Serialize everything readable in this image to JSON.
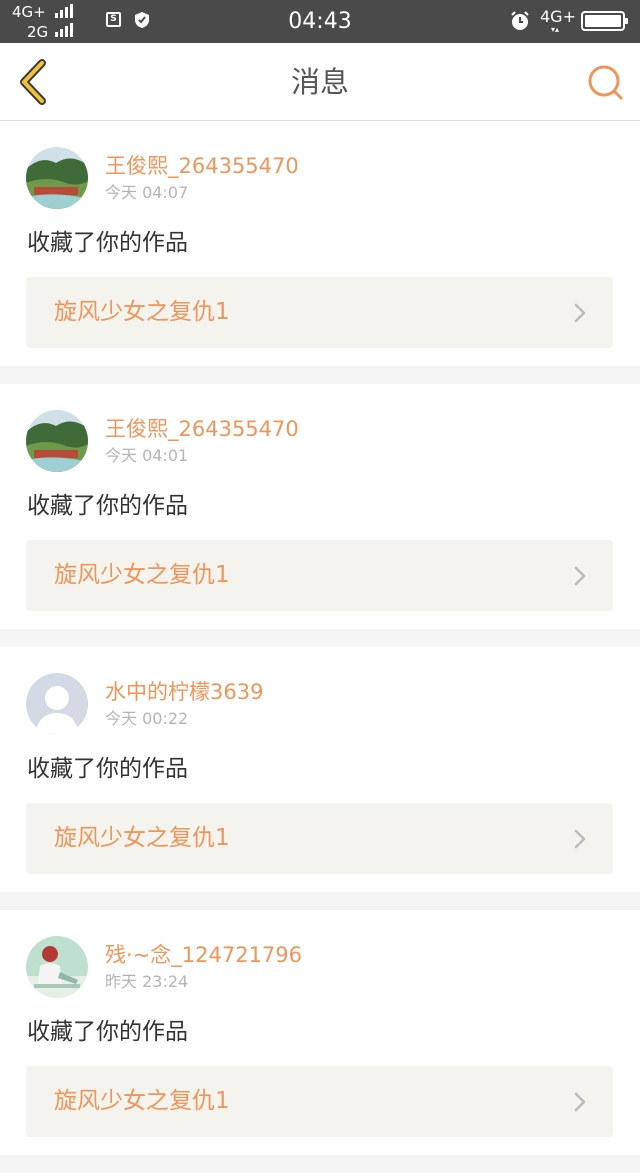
{
  "status_bar": {
    "network_top": "4G+",
    "network_bottom": "2G",
    "time": "04:43",
    "network_right": "4G+",
    "sim_icon_letter": "S"
  },
  "nav": {
    "title": "消息",
    "back_icon": "chevron-left-icon",
    "search_icon": "search-icon",
    "accent_color": "#f0955a"
  },
  "messages": [
    {
      "user": "王俊熙_264355470",
      "time": "今天 04:07",
      "action": "收藏了你的作品",
      "work": "旋风少女之复仇1",
      "avatar": "landscape-photo"
    },
    {
      "user": "王俊熙_264355470",
      "time": "今天 04:01",
      "action": "收藏了你的作品",
      "work": "旋风少女之复仇1",
      "avatar": "landscape-photo"
    },
    {
      "user": "水中的柠檬3639",
      "time": "今天 00:22",
      "action": "收藏了你的作品",
      "work": "旋风少女之复仇1",
      "avatar": "default-user"
    },
    {
      "user": "残·~念_124721796",
      "time": "昨天 23:24",
      "action": "收藏了你的作品",
      "work": "旋风少女之复仇1",
      "avatar": "person-photo"
    }
  ]
}
